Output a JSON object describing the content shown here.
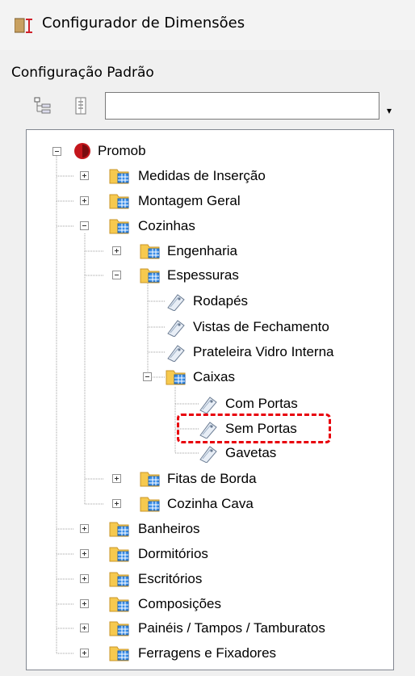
{
  "window": {
    "title": "Configurador de Dimensões",
    "icon": "ruler-icon"
  },
  "section_label": "Configuração Padrão",
  "toolbar": {
    "buttons": [
      {
        "icon": "expand-tree-icon"
      },
      {
        "icon": "collapse-tree-icon"
      }
    ],
    "search_value": "",
    "dropdown_icon": "chevron-down-icon"
  },
  "tree": {
    "root": "Promob",
    "items": [
      {
        "label": "Medidas de Inserção"
      },
      {
        "label": "Montagem Geral"
      },
      {
        "label": "Cozinhas"
      },
      {
        "label": "Engenharia"
      },
      {
        "label": "Espessuras"
      },
      {
        "label": "Rodapés"
      },
      {
        "label": "Vistas de Fechamento"
      },
      {
        "label": "Prateleira Vidro Interna"
      },
      {
        "label": "Caixas"
      },
      {
        "label": "Com Portas"
      },
      {
        "label": "Sem Portas"
      },
      {
        "label": "Gavetas"
      },
      {
        "label": "Fitas de Borda"
      },
      {
        "label": "Cozinha Cava"
      },
      {
        "label": "Banheiros"
      },
      {
        "label": "Dormitórios"
      },
      {
        "label": "Escritórios"
      },
      {
        "label": "Composições"
      },
      {
        "label": "Painéis / Tampos / Tamburatos"
      },
      {
        "label": "Ferragens e Fixadores"
      }
    ]
  },
  "highlight_color": "#e8000b"
}
